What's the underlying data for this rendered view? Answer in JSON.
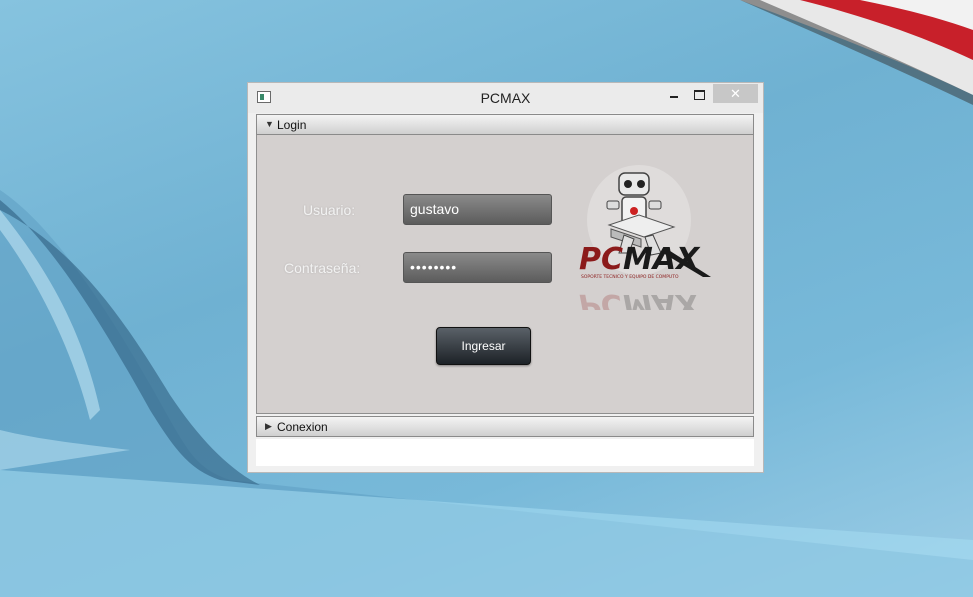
{
  "window": {
    "title": "PCMAX",
    "close_glyph": "✕"
  },
  "panels": {
    "login": {
      "label": "Login",
      "expanded": true,
      "arrow_icon": "triangle-down-icon"
    },
    "conexion": {
      "label": "Conexion",
      "expanded": false,
      "arrow_icon": "triangle-right-icon"
    }
  },
  "form": {
    "usuario_label": "Usuario:",
    "usuario_value": "gustavo",
    "password_label": "Contraseña:",
    "password_value": "••••••••",
    "submit_label": "Ingresar"
  },
  "logo": {
    "text": "PCMAX",
    "tagline": "SOPORTE TECNICO Y EQUIPO DE COMPUTO",
    "colors": {
      "pc": "#8b1a1a",
      "max": "#1a1a1a"
    }
  },
  "colors": {
    "panel_bg": "#d4d0cf",
    "field_bg": "#6e6e6e",
    "button_bg": "#2a2f34"
  }
}
